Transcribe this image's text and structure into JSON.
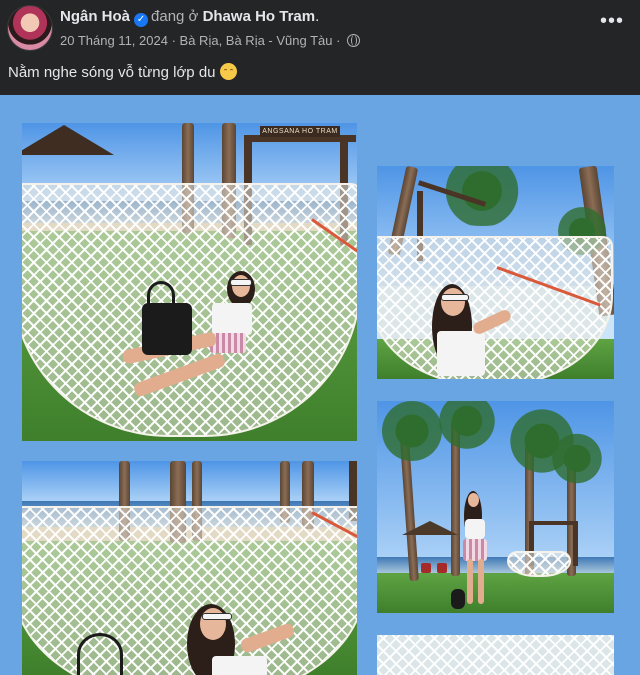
{
  "post": {
    "author": "Ngân Hoà",
    "verb": "đang ở",
    "place": "Dhawa Ho Tram",
    "place_suffix": ".",
    "date": "20 Tháng 11, 2024",
    "separator": "·",
    "location": "Bà Rịa, Bà Rịa - Vũng Tàu",
    "caption": "Nằm nghe sóng vỗ từng lớp du",
    "more_label": "•••"
  },
  "gallery": {
    "sign_text": "ANGSANA HO TRAM",
    "background_color": "#6aa5e3"
  },
  "icons": {
    "verified": "verified-badge-icon",
    "audience": "globe-icon",
    "emoji": "smiling-face-emoji",
    "more": "more-options-icon"
  },
  "colors": {
    "background": "#242526",
    "primary_text": "#e4e6eb",
    "secondary_text": "#b0b3b8",
    "verified_blue": "#1877f2"
  }
}
